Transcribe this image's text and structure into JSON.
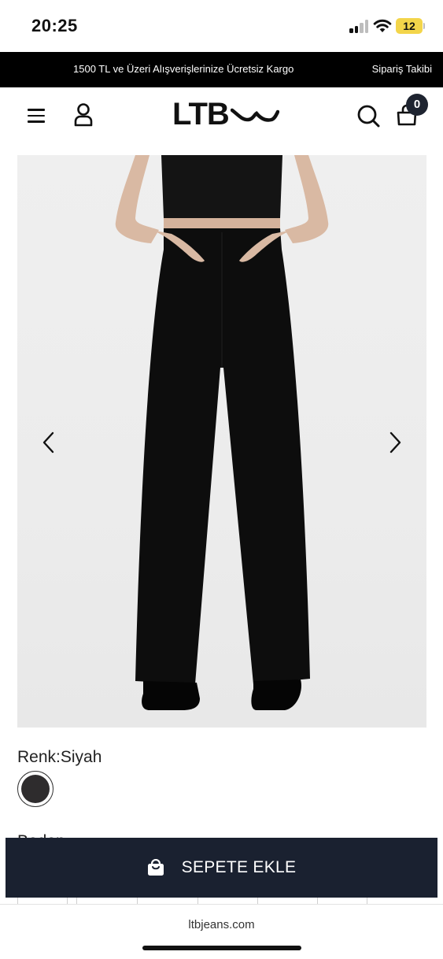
{
  "status_bar": {
    "time": "20:25",
    "battery_level": "12",
    "icons": [
      "cellular-signal-icon",
      "wifi-icon",
      "battery-icon"
    ]
  },
  "announcement": {
    "text": "1500 TL ve Üzeri Alışverişlerinize Ücretsiz Kargo",
    "order_tracking": "Sipariş Takibi"
  },
  "header": {
    "logo_text": "LTB",
    "cart_count": "0",
    "icons": [
      "menu-icon",
      "user-icon",
      "search-icon",
      "shopping-bag-icon"
    ]
  },
  "product": {
    "color_label": "Renk:Siyah",
    "color_swatch": "#2e2c2d",
    "partial_label": "Beden",
    "gallery_icons": [
      "chevron-left-icon",
      "chevron-right-icon"
    ]
  },
  "cta": {
    "add_to_cart": "SEPETE EKLE",
    "background": "#1a2130"
  },
  "browser": {
    "url": "ltbjeans.com"
  }
}
